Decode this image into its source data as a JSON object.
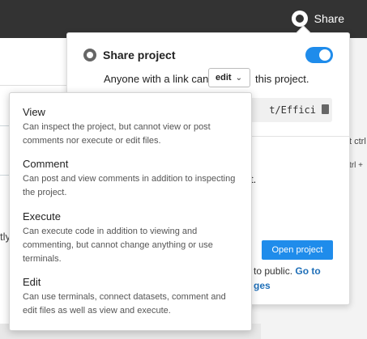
{
  "topbar": {
    "share_label": "Share"
  },
  "background": {
    "frag_ly": "tly",
    "right_frag1": "t ctrl",
    "right_frag2": "trl +"
  },
  "share_panel": {
    "title": "Share project",
    "toggle_on": true,
    "link_prefix": "Anyone with a link can",
    "permission": "edit",
    "link_suffix": "this project.",
    "url": "t/Effici",
    "frag_t": "t.",
    "open_button": "Open project",
    "public_text": "to public.",
    "go_to": "Go to",
    "ges": "ges"
  },
  "dropdown": {
    "options": [
      {
        "title": "View",
        "desc": "Can inspect the project, but cannot view or post comments nor execute or edit files."
      },
      {
        "title": "Comment",
        "desc": "Can post and view comments in addition to inspecting the project."
      },
      {
        "title": "Execute",
        "desc": "Can execute code in addition to viewing and commenting, but cannot change anything or use terminals."
      },
      {
        "title": "Edit",
        "desc": "Can use terminals, connect datasets, comment and edit files as well as view and execute."
      }
    ]
  },
  "colors": {
    "accent": "#1f8ceb",
    "topbar": "#333333"
  }
}
